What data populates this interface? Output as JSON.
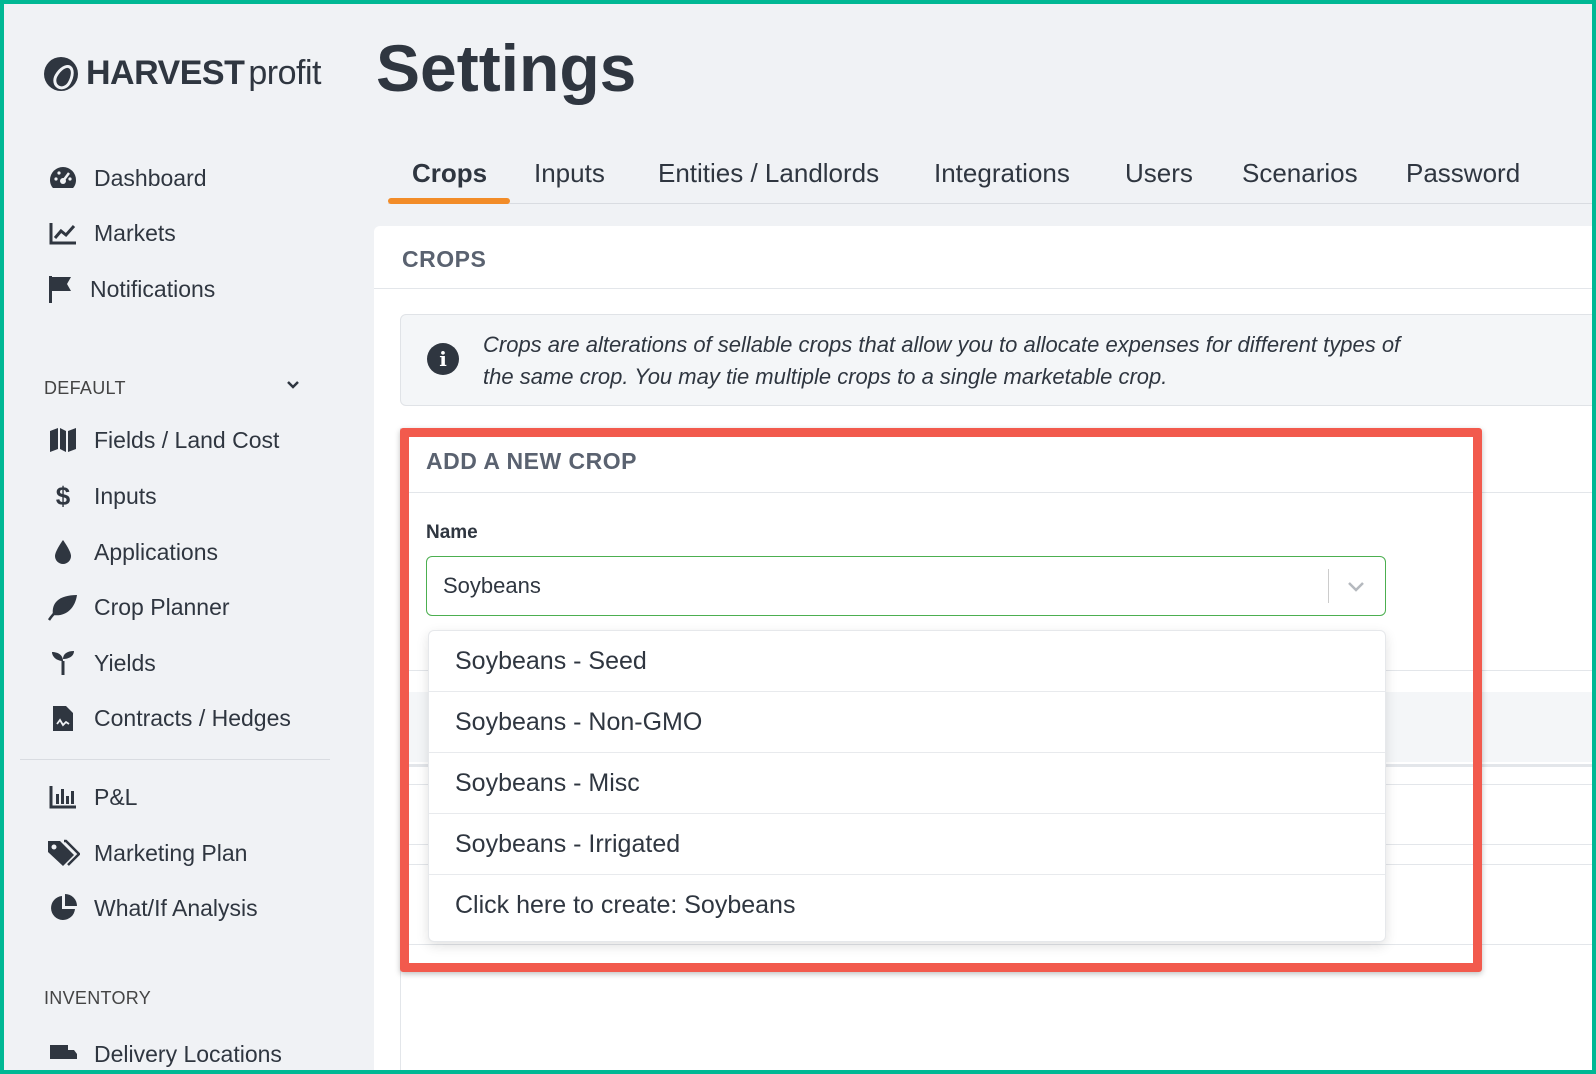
{
  "brand": {
    "bold": "HARVEST",
    "light": "profit"
  },
  "sidebar": {
    "top_items": [
      {
        "label": "Dashboard",
        "icon": "gauge-icon"
      },
      {
        "label": "Markets",
        "icon": "chart-line-icon"
      },
      {
        "label": "Notifications",
        "icon": "flag-icon"
      }
    ],
    "default_label": "DEFAULT",
    "default_items": [
      {
        "label": "Fields / Land Cost",
        "icon": "map-icon"
      },
      {
        "label": "Inputs",
        "icon": "dollar-icon"
      },
      {
        "label": "Applications",
        "icon": "droplet-icon"
      },
      {
        "label": "Crop Planner",
        "icon": "leaf-icon"
      },
      {
        "label": "Yields",
        "icon": "seedling-icon"
      },
      {
        "label": "Contracts / Hedges",
        "icon": "contract-icon"
      }
    ],
    "analysis_items": [
      {
        "label": "P&L",
        "icon": "bar-chart-icon"
      },
      {
        "label": "Marketing Plan",
        "icon": "tags-icon"
      },
      {
        "label": "What/If Analysis",
        "icon": "pie-chart-icon"
      }
    ],
    "inventory_label": "INVENTORY",
    "inventory_items": [
      {
        "label": "Delivery Locations",
        "icon": "truck-icon"
      }
    ]
  },
  "page": {
    "title": "Settings"
  },
  "tabs": [
    "Crops",
    "Inputs",
    "Entities / Landlords",
    "Integrations",
    "Users",
    "Scenarios",
    "Password"
  ],
  "crops_card": {
    "title": "CROPS",
    "info_text": "Crops are alterations of sellable crops that allow you to allocate expenses for different types of the same crop. You may tie multiple crops to a single marketable crop."
  },
  "add_crop": {
    "title": "ADD A NEW CROP",
    "name_label": "Name",
    "name_value": "Soybeans",
    "options": [
      "Soybeans - Seed",
      "Soybeans - Non-GMO",
      "Soybeans - Misc",
      "Soybeans - Irrigated",
      "Click here to create: Soybeans"
    ]
  },
  "colors": {
    "accent": "#f28c28",
    "highlight": "#f25a4d",
    "focus": "#4caf50",
    "frame": "#00b894"
  }
}
